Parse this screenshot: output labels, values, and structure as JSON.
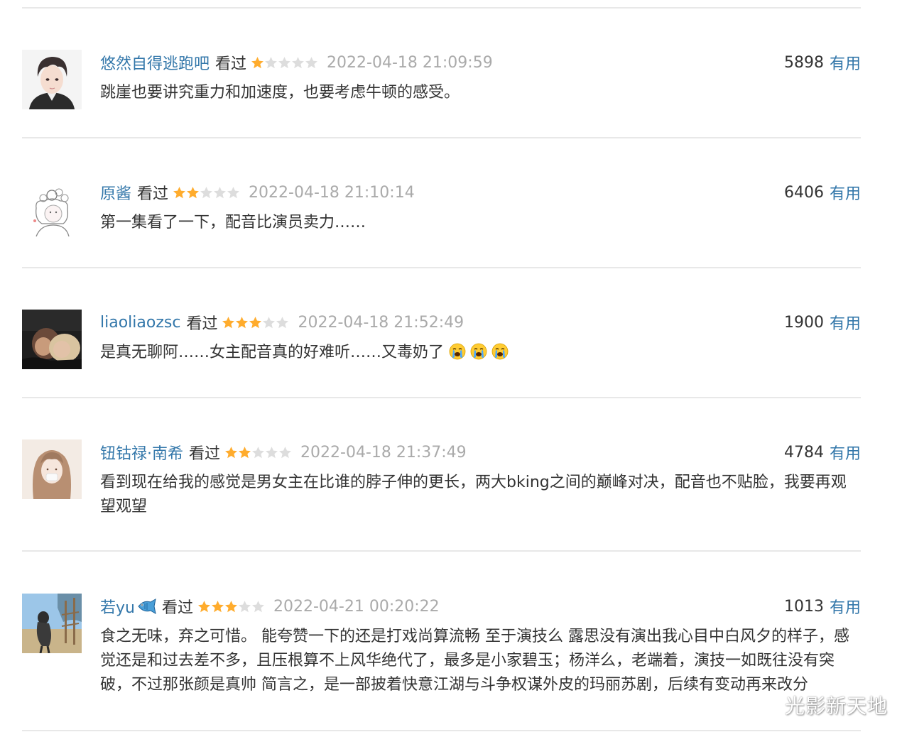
{
  "colors": {
    "link": "#3377aa",
    "star_filled": "#ffac2d",
    "star_empty": "#dddddd",
    "meta_gray": "#aaaaaa",
    "divider": "#e8e8e8"
  },
  "comments": [
    {
      "user": "悠然自得逃跑吧",
      "status": "看过",
      "rating": 1,
      "time": "2022-04-18 21:09:59",
      "votes": "5898",
      "useful_label": "有用",
      "text": "跳崖也要讲究重力和加速度，也要考虑牛顿的感受。"
    },
    {
      "user": "原酱",
      "status": "看过",
      "rating": 2,
      "time": "2022-04-18 21:10:14",
      "votes": "6406",
      "useful_label": "有用",
      "text": "第一集看了一下，配音比演员卖力……"
    },
    {
      "user": "liaoliaozsc",
      "status": "看过",
      "rating": 3,
      "time": "2022-04-18 21:52:49",
      "votes": "1900",
      "useful_label": "有用",
      "text": "是真无聊阿……女主配音真的好难听……又毒奶了",
      "emojis": [
        "crying-face-icon",
        "crying-face-icon",
        "crying-face-icon"
      ]
    },
    {
      "user": "钮钴禄·南希",
      "status": "看过",
      "rating": 2,
      "time": "2022-04-18 21:37:49",
      "votes": "4784",
      "useful_label": "有用",
      "text": "看到现在给我的感觉是男女主在比谁的脖子伸的更长，两大bking之间的巅峰对决，配音也不贴脸，我要再观望观望"
    },
    {
      "user": "若yu",
      "user_icon": "fish-icon",
      "status": "看过",
      "rating": 3,
      "time": "2022-04-21 00:20:22",
      "votes": "1013",
      "useful_label": "有用",
      "text": "食之无味，弃之可惜。 能夸赞一下的还是打戏尚算流畅 至于演技么 露思没有演出我心目中白风夕的样子，感觉还是和过去差不多，且压根算不上风华绝代了，最多是小家碧玉；杨洋么，老端着，演技一如既往没有突破，不过那张颜是真帅 简言之，是一部披着快意江湖与斗争权谋外皮的玛丽苏剧，后续有变动再来改分"
    }
  ],
  "watermark": "光影新天地"
}
